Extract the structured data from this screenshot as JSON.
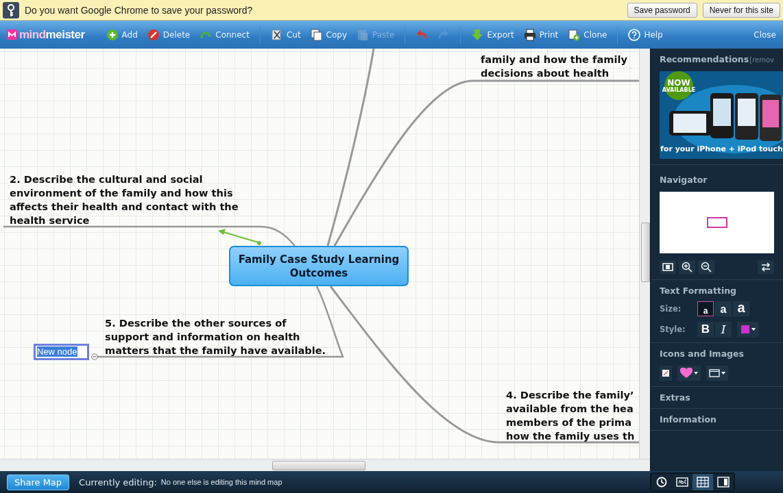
{
  "infobar": {
    "message": "Do you want Google Chrome to save your password?",
    "buttons": [
      "Save password",
      "Never for this site"
    ]
  },
  "toolbar": {
    "logo": {
      "part1": "mind",
      "part2": "meister"
    },
    "groups": [
      [
        {
          "kind": "add",
          "label": "Add",
          "disabled": false
        },
        {
          "kind": "delete",
          "label": "Delete",
          "disabled": false
        },
        {
          "kind": "connect",
          "label": "Connect",
          "disabled": false
        }
      ],
      [
        {
          "kind": "cut",
          "label": "Cut",
          "disabled": false
        },
        {
          "kind": "copy",
          "label": "Copy",
          "disabled": false
        },
        {
          "kind": "paste",
          "label": "Paste",
          "disabled": true
        }
      ],
      [
        {
          "kind": "undo",
          "disabled": false
        },
        {
          "kind": "redo",
          "disabled": true
        }
      ],
      [
        {
          "kind": "export",
          "label": "Export",
          "disabled": false
        },
        {
          "kind": "print",
          "label": "Print",
          "disabled": false
        },
        {
          "kind": "clone",
          "label": "Clone",
          "disabled": false
        }
      ],
      [
        {
          "kind": "help",
          "label": "Help",
          "disabled": false
        }
      ]
    ],
    "close": "Close"
  },
  "canvas": {
    "central": {
      "lines": [
        "Family Case Study Learning",
        "Outcomes"
      ]
    },
    "nodes": [
      {
        "lines": [
          "family and how the family",
          "decisions about health"
        ]
      },
      {
        "lines": [
          "2. Describe the cultural and social",
          "environment of the family and how this",
          "affects their health and contact with the",
          "health service"
        ]
      },
      {
        "lines": [
          "5. Describe the other sources of",
          "support and information on health",
          "matters that the family have available."
        ]
      },
      {
        "lines": [
          "4. Describe the family’",
          "available from the hea",
          "members of the prima",
          "how the family uses th"
        ]
      }
    ],
    "new_node": {
      "value": "New node",
      "selected": true
    }
  },
  "sidebar": {
    "recommendations": {
      "title": "Recommendations",
      "remove": "[remov",
      "ad_badge": [
        "NOW",
        "AVAILABLE"
      ],
      "ad_caption": "for your iPhone + iPod touch"
    },
    "navigator": {
      "title": "Navigator"
    },
    "text_formatting": {
      "title": "Text Formatting",
      "size_label": "Size:",
      "sizes": [
        {
          "label": "a",
          "selected": true
        },
        {
          "label": "a",
          "selected": false
        },
        {
          "label": "a",
          "selected": false
        }
      ],
      "style_label": "Style:",
      "bold": "B",
      "italic": "I",
      "color": "#cc33cc"
    },
    "icons_images": {
      "title": "Icons and Images"
    },
    "extras": {
      "title": "Extras"
    },
    "information": {
      "title": "Information"
    }
  },
  "status_bar": {
    "share": "Share Map",
    "label": "Currently editing:",
    "value": "No one else is editing this mind map",
    "views": [
      {
        "kind": "history",
        "selected": false
      },
      {
        "kind": "spellcheck",
        "selected": false
      },
      {
        "kind": "grid",
        "selected": true
      },
      {
        "kind": "panel",
        "selected": false
      }
    ]
  }
}
